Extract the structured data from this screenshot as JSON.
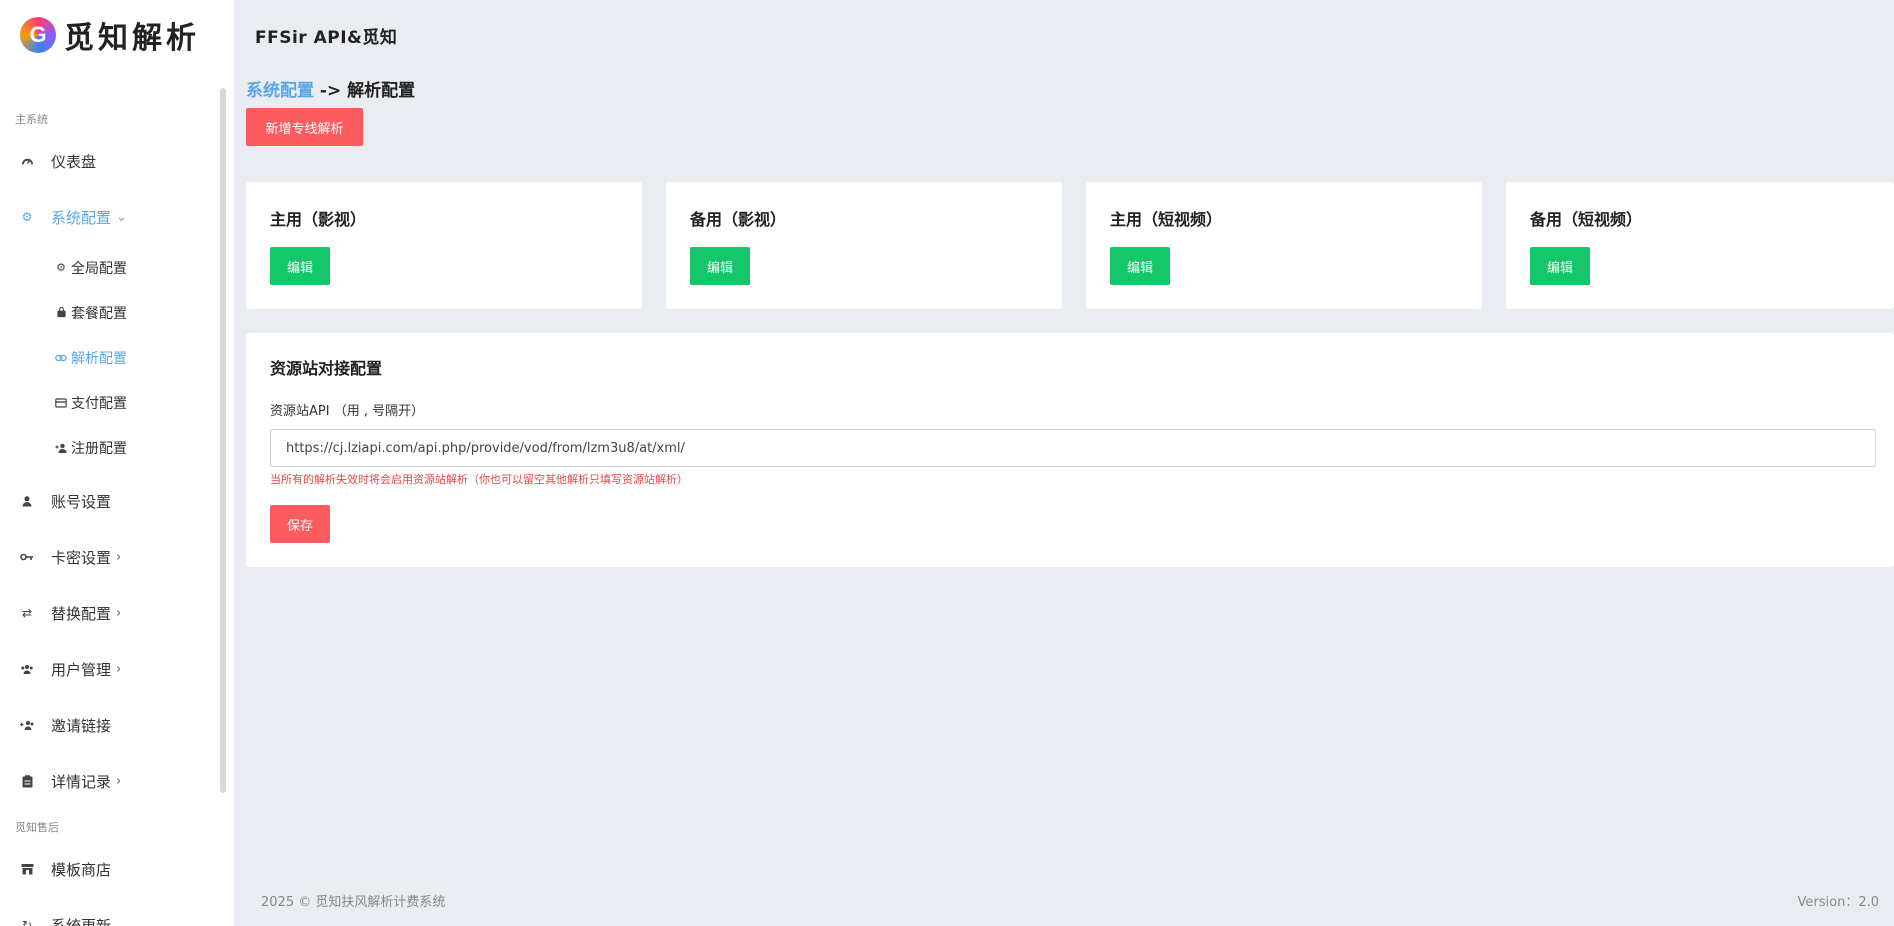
{
  "logo": {
    "mark": "G",
    "text": "觅知解析"
  },
  "sidebar": {
    "section_main": "主系统",
    "dashboard": "仪表盘",
    "system_config": "系统配置",
    "sub_items": [
      "全局配置",
      "套餐配置",
      "解析配置",
      "支付配置",
      "注册配置"
    ],
    "account_settings": "账号设置",
    "card_settings": "卡密设置",
    "replace_config": "替换配置",
    "user_management": "用户管理",
    "invite_link": "邀请链接",
    "detail_records": "详情记录",
    "section_after_sale": "觅知售后",
    "template_store": "模板商店",
    "system_update": "系统更新"
  },
  "topbar": {
    "title": "FFSir API&觅知"
  },
  "breadcrumb": {
    "parent": "系统配置",
    "separator": " -> ",
    "current": "解析配置"
  },
  "add_button": "新增专线解析",
  "cards": [
    {
      "title": "主用（影视）",
      "button": "编辑"
    },
    {
      "title": "备用（影视）",
      "button": "编辑"
    },
    {
      "title": "主用（短视频）",
      "button": "编辑"
    },
    {
      "title": "备用（短视频）",
      "button": "编辑"
    }
  ],
  "resource": {
    "title": "资源站对接配置",
    "label": "资源站API （用 , 号隔开）",
    "value": "https://cj.lziapi.com/api.php/provide/vod/from/lzm3u8/at/xml/",
    "hint": "当所有的解析失效时将会启用资源站解析（你也可以留空其他解析只填写资源站解析）",
    "save": "保存"
  },
  "footer": {
    "copyright": "2025 © 觅知扶风解析计费系统",
    "version": "Version：2.0"
  }
}
